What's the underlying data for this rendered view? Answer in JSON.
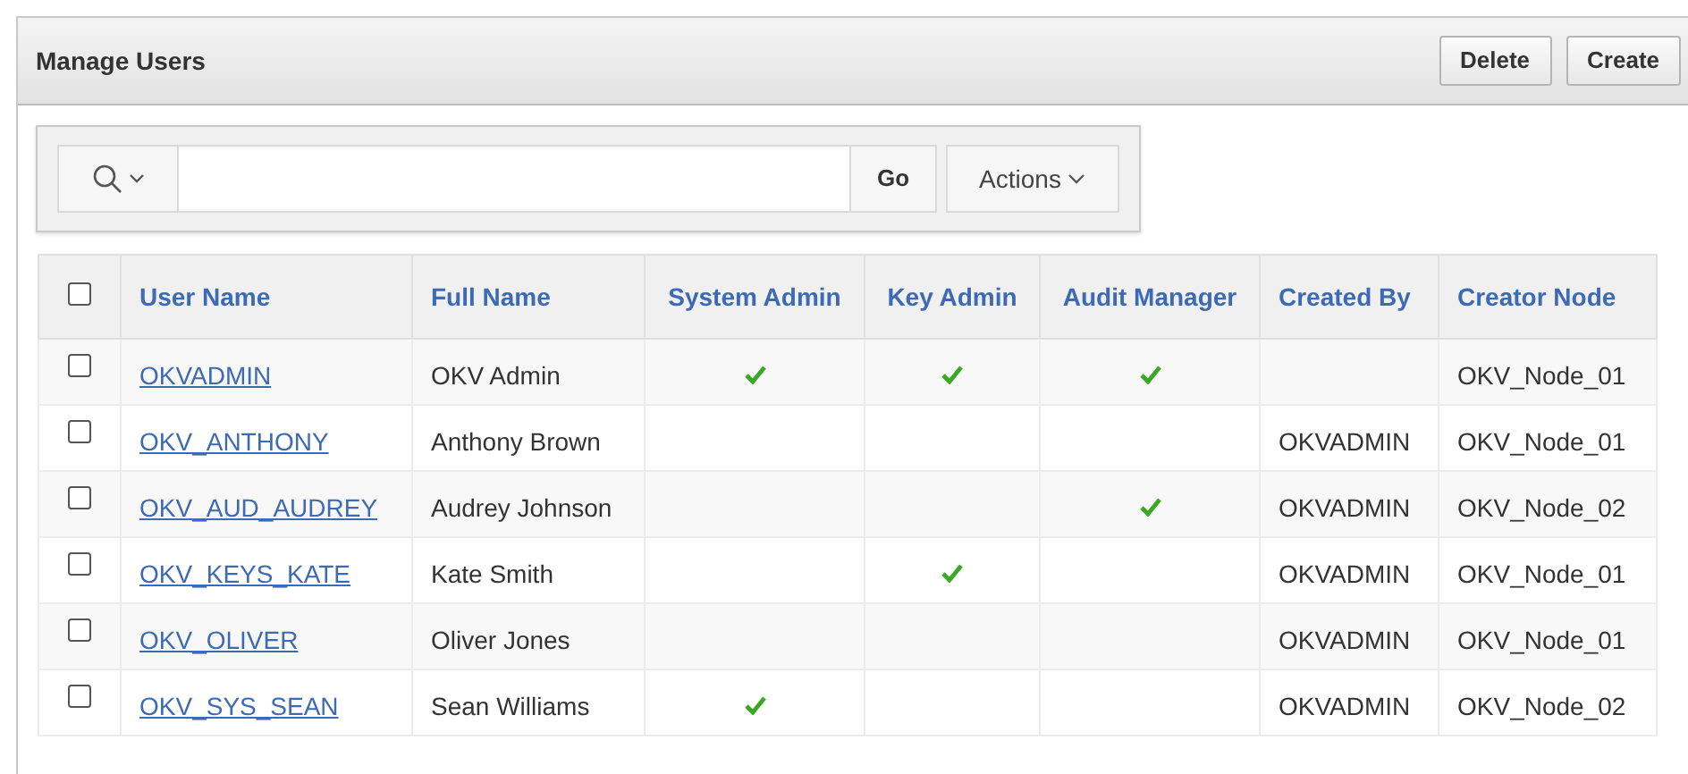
{
  "panel": {
    "title": "Manage Users",
    "buttons": [
      "Delete",
      "Create"
    ]
  },
  "toolbar": {
    "go": "Go",
    "actions": "Actions"
  },
  "table": {
    "select_all": {
      "checked": false
    },
    "columns": [
      "User Name",
      "Full Name",
      "System Admin",
      "Key Admin",
      "Audit Manager",
      "Created By",
      "Creator Node"
    ],
    "rows": [
      {
        "checked": false,
        "user_name": "OKVADMIN",
        "full_name": "OKV Admin",
        "system_admin": true,
        "key_admin": true,
        "audit_manager": true,
        "created_by": "",
        "creator_node": "OKV_Node_01"
      },
      {
        "checked": false,
        "user_name": "OKV_ANTHONY",
        "full_name": "Anthony Brown",
        "system_admin": false,
        "key_admin": false,
        "audit_manager": false,
        "created_by": "OKVADMIN",
        "creator_node": "OKV_Node_01"
      },
      {
        "checked": false,
        "user_name": "OKV_AUD_AUDREY",
        "full_name": "Audrey Johnson",
        "system_admin": false,
        "key_admin": false,
        "audit_manager": true,
        "created_by": "OKVADMIN",
        "creator_node": "OKV_Node_02"
      },
      {
        "checked": false,
        "user_name": "OKV_KEYS_KATE",
        "full_name": "Kate Smith",
        "system_admin": false,
        "key_admin": true,
        "audit_manager": false,
        "created_by": "OKVADMIN",
        "creator_node": "OKV_Node_01"
      },
      {
        "checked": false,
        "user_name": "OKV_OLIVER",
        "full_name": "Oliver Jones",
        "system_admin": false,
        "key_admin": false,
        "audit_manager": false,
        "created_by": "OKVADMIN",
        "creator_node": "OKV_Node_01"
      },
      {
        "checked": false,
        "user_name": "OKV_SYS_SEAN",
        "full_name": "Sean Williams",
        "system_admin": true,
        "key_admin": false,
        "audit_manager": false,
        "created_by": "OKVADMIN",
        "creator_node": "OKV_Node_02"
      }
    ]
  }
}
